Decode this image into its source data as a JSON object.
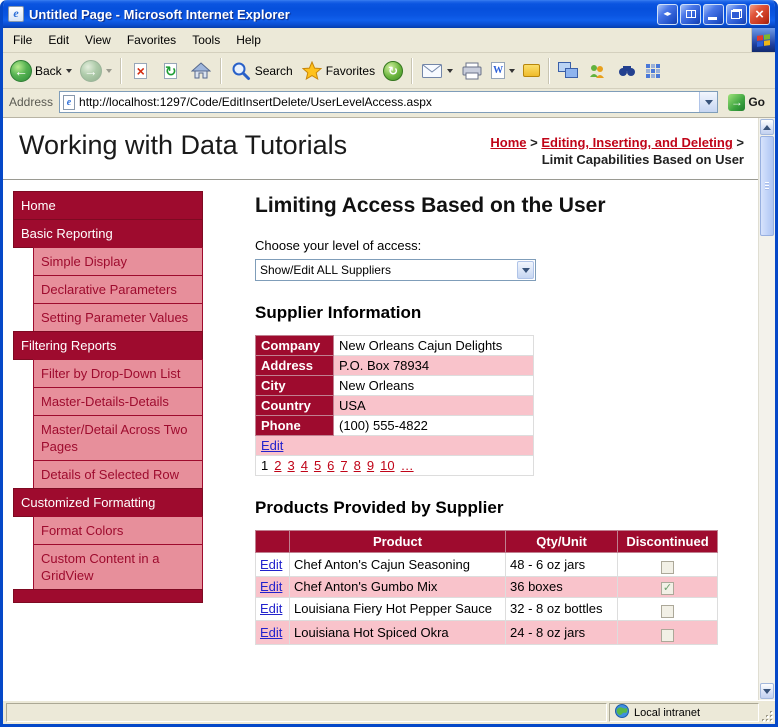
{
  "window": {
    "title": "Untitled Page - Microsoft Internet Explorer"
  },
  "menu": {
    "items": [
      "File",
      "Edit",
      "View",
      "Favorites",
      "Tools",
      "Help"
    ]
  },
  "toolbar": {
    "back_label": "Back",
    "search_label": "Search",
    "favorites_label": "Favorites"
  },
  "address": {
    "label": "Address",
    "url": "http://localhost:1297/Code/EditInsertDelete/UserLevelAccess.aspx",
    "go_label": "Go"
  },
  "header": {
    "title": "Working with Data Tutorials",
    "breadcrumb": {
      "link1": "Home",
      "sep1": ">",
      "link2": "Editing, Inserting, and Deleting",
      "sep2": ">",
      "current": "Limit Capabilities Based on User"
    }
  },
  "sidebar": {
    "items": [
      {
        "label": "Home"
      },
      {
        "label": "Basic Reporting"
      },
      {
        "label": "Simple Display"
      },
      {
        "label": "Declarative Parameters"
      },
      {
        "label": "Setting Parameter Values"
      },
      {
        "label": "Filtering Reports"
      },
      {
        "label": "Filter by Drop-Down List"
      },
      {
        "label": "Master-Details-Details"
      },
      {
        "label": "Master/Detail Across Two Pages"
      },
      {
        "label": "Details of Selected Row"
      },
      {
        "label": "Customized Formatting"
      },
      {
        "label": "Format Colors"
      },
      {
        "label": "Custom Content in a GridView"
      }
    ]
  },
  "main": {
    "heading": "Limiting Access Based on the User",
    "access_label": "Choose your level of access:",
    "access_value": "Show/Edit ALL Suppliers",
    "supplier_heading": "Supplier Information",
    "supplier": {
      "rows": [
        {
          "field": "Company",
          "value": "New Orleans Cajun Delights"
        },
        {
          "field": "Address",
          "value": "P.O. Box 78934"
        },
        {
          "field": "City",
          "value": "New Orleans"
        },
        {
          "field": "Country",
          "value": "USA"
        },
        {
          "field": "Phone",
          "value": "(100) 555-4822"
        }
      ],
      "edit_label": "Edit",
      "pager": [
        "1",
        "2",
        "3",
        "4",
        "5",
        "6",
        "7",
        "8",
        "9",
        "10",
        "…"
      ]
    },
    "products_heading": "Products Provided by Supplier",
    "products": {
      "headers": [
        "",
        "Product",
        "Qty/Unit",
        "Discontinued"
      ],
      "edit_label": "Edit",
      "rows": [
        {
          "product": "Chef Anton's Cajun Seasoning",
          "qty": "48 - 6 oz jars",
          "check": ""
        },
        {
          "product": "Chef Anton's Gumbo Mix",
          "qty": "36 boxes",
          "check": "✓"
        },
        {
          "product": "Louisiana Fiery Hot Pepper Sauce",
          "qty": "32 - 8 oz bottles",
          "check": ""
        },
        {
          "product": "Louisiana Hot Spiced Okra",
          "qty": "24 - 8 oz jars",
          "check": ""
        }
      ]
    }
  },
  "statusbar": {
    "zone": "Local intranet"
  },
  "colors": {
    "accent_red": "#9E0B2E",
    "sub_pink": "#E78F9B",
    "row_pink": "#F9C3CB",
    "link_red": "#C00418",
    "link_blue": "#2222CC",
    "xp_blue": "#0054E3"
  }
}
